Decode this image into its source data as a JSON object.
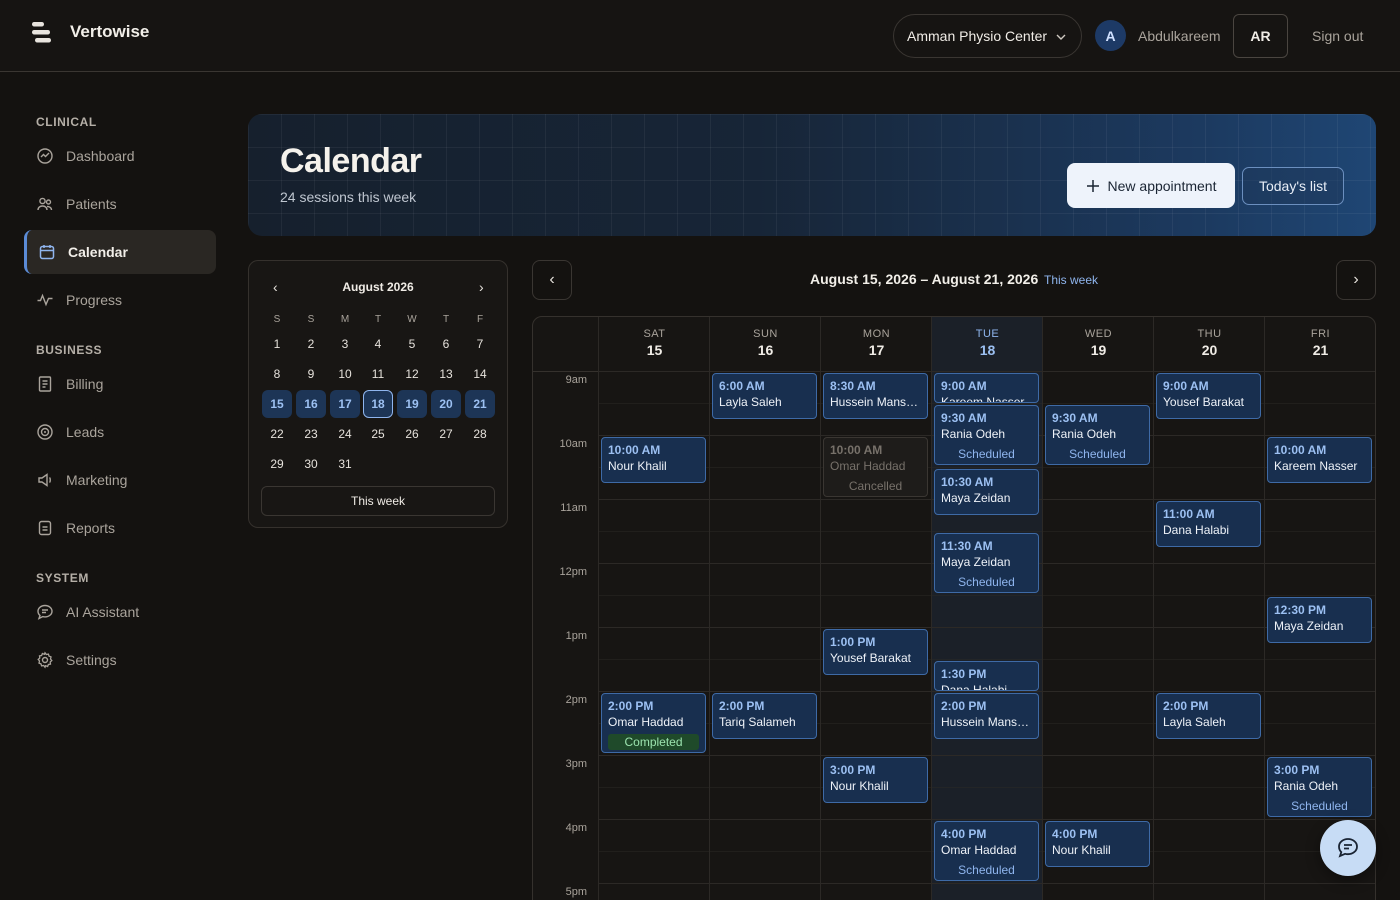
{
  "brand": "Vertowise",
  "header": {
    "clinic": "Amman Physio Center",
    "avatar_initial": "A",
    "user_name": "Abdulkareem",
    "lang": "AR",
    "sign_out": "Sign out"
  },
  "sidebar": {
    "sections": [
      "CLINICAL",
      "BUSINESS",
      "SYSTEM"
    ],
    "items": [
      {
        "label": "Dashboard",
        "icon": "dashboard-icon"
      },
      {
        "label": "Patients",
        "icon": "patients-icon"
      },
      {
        "label": "Calendar",
        "icon": "calendar-icon",
        "active": true
      },
      {
        "label": "Progress",
        "icon": "progress-icon"
      },
      {
        "label": "Billing",
        "icon": "billing-icon"
      },
      {
        "label": "Leads",
        "icon": "leads-icon"
      },
      {
        "label": "Marketing",
        "icon": "marketing-icon"
      },
      {
        "label": "Reports",
        "icon": "reports-icon"
      },
      {
        "label": "AI Assistant",
        "icon": "ai-assistant-icon"
      },
      {
        "label": "Settings",
        "icon": "settings-icon"
      }
    ]
  },
  "hero": {
    "title": "Calendar",
    "subtitle": "24 sessions this week",
    "new_appointment": "New appointment",
    "todays_list": "Today's list"
  },
  "mini_calendar": {
    "prev": "‹",
    "next": "›",
    "month": "August 2026",
    "dow": [
      "S",
      "S",
      "M",
      "T",
      "W",
      "T",
      "F"
    ],
    "weeks": [
      [
        "1",
        "2",
        "3",
        "4",
        "5",
        "6",
        "7"
      ],
      [
        "8",
        "9",
        "10",
        "11",
        "12",
        "13",
        "14"
      ],
      [
        "15",
        "16",
        "17",
        "18",
        "19",
        "20",
        "21"
      ],
      [
        "22",
        "23",
        "24",
        "25",
        "26",
        "27",
        "28"
      ],
      [
        "29",
        "30",
        "31"
      ]
    ],
    "highlight_week": 2,
    "today": "18",
    "this_week": "This week"
  },
  "week": {
    "prev": "‹",
    "next": "›",
    "range": "August 15, 2026 – August 21, 2026",
    "this_week": "This week",
    "days": [
      {
        "dow": "SAT",
        "num": "15"
      },
      {
        "dow": "SUN",
        "num": "16"
      },
      {
        "dow": "MON",
        "num": "17"
      },
      {
        "dow": "TUE",
        "num": "18",
        "today": true
      },
      {
        "dow": "WED",
        "num": "19"
      },
      {
        "dow": "THU",
        "num": "20"
      },
      {
        "dow": "FRI",
        "num": "21"
      }
    ],
    "hours": [
      "9am",
      "10am",
      "11am",
      "12pm",
      "1pm",
      "2pm",
      "3pm",
      "4pm",
      "5pm"
    ],
    "events": [
      {
        "day": 0,
        "start": 10.0,
        "time": "10:00 AM",
        "name": "Nour Khalil"
      },
      {
        "day": 0,
        "start": 14.0,
        "time": "2:00 PM",
        "name": "Omar Haddad",
        "status": "Completed",
        "kind": "done"
      },
      {
        "day": 1,
        "start": 9.0,
        "time": "6:00 AM",
        "name": "Layla Saleh"
      },
      {
        "day": 1,
        "start": 14.0,
        "time": "2:00 PM",
        "name": "Tariq Salameh"
      },
      {
        "day": 2,
        "start": 9.0,
        "time": "8:30 AM",
        "name": "Hussein Mansour"
      },
      {
        "day": 2,
        "start": 10.0,
        "time": "10:00 AM",
        "name": "Omar Haddad",
        "status": "Cancelled",
        "kind": "cancel"
      },
      {
        "day": 2,
        "start": 13.0,
        "time": "1:00 PM",
        "name": "Yousef Barakat"
      },
      {
        "day": 2,
        "start": 15.0,
        "time": "3:00 PM",
        "name": "Nour Khalil"
      },
      {
        "day": 3,
        "start": 9.0,
        "time": "9:00 AM",
        "name": "Kareem Nasser",
        "short": true
      },
      {
        "day": 3,
        "start": 9.5,
        "time": "9:30 AM",
        "name": "Rania Odeh",
        "status": "Scheduled"
      },
      {
        "day": 3,
        "start": 10.5,
        "time": "10:30 AM",
        "name": "Maya Zeidan"
      },
      {
        "day": 3,
        "start": 11.5,
        "time": "11:30 AM",
        "name": "Maya Zeidan",
        "status": "Scheduled"
      },
      {
        "day": 3,
        "start": 13.5,
        "time": "1:30 PM",
        "name": "Dana Halabi",
        "short": true
      },
      {
        "day": 3,
        "start": 14.0,
        "time": "2:00 PM",
        "name": "Hussein Mansour"
      },
      {
        "day": 3,
        "start": 16.0,
        "time": "4:00 PM",
        "name": "Omar Haddad",
        "status": "Scheduled"
      },
      {
        "day": 4,
        "start": 9.5,
        "time": "9:30 AM",
        "name": "Rania Odeh",
        "status": "Scheduled"
      },
      {
        "day": 4,
        "start": 16.0,
        "time": "4:00 PM",
        "name": "Nour Khalil"
      },
      {
        "day": 5,
        "start": 9.0,
        "time": "9:00 AM",
        "name": "Yousef Barakat"
      },
      {
        "day": 5,
        "start": 11.0,
        "time": "11:00 AM",
        "name": "Dana Halabi"
      },
      {
        "day": 5,
        "start": 14.0,
        "time": "2:00 PM",
        "name": "Layla Saleh"
      },
      {
        "day": 6,
        "start": 10.0,
        "time": "10:00 AM",
        "name": "Kareem Nasser"
      },
      {
        "day": 6,
        "start": 12.5,
        "time": "12:30 PM",
        "name": "Maya Zeidan"
      },
      {
        "day": 6,
        "start": 15.0,
        "time": "3:00 PM",
        "name": "Rania Odeh",
        "status": "Scheduled"
      }
    ]
  },
  "colors": {
    "accent": "#8fb5ee",
    "event_bg": "#182f4f",
    "event_border": "#3e6aa6",
    "completed": "#9be3ae"
  }
}
